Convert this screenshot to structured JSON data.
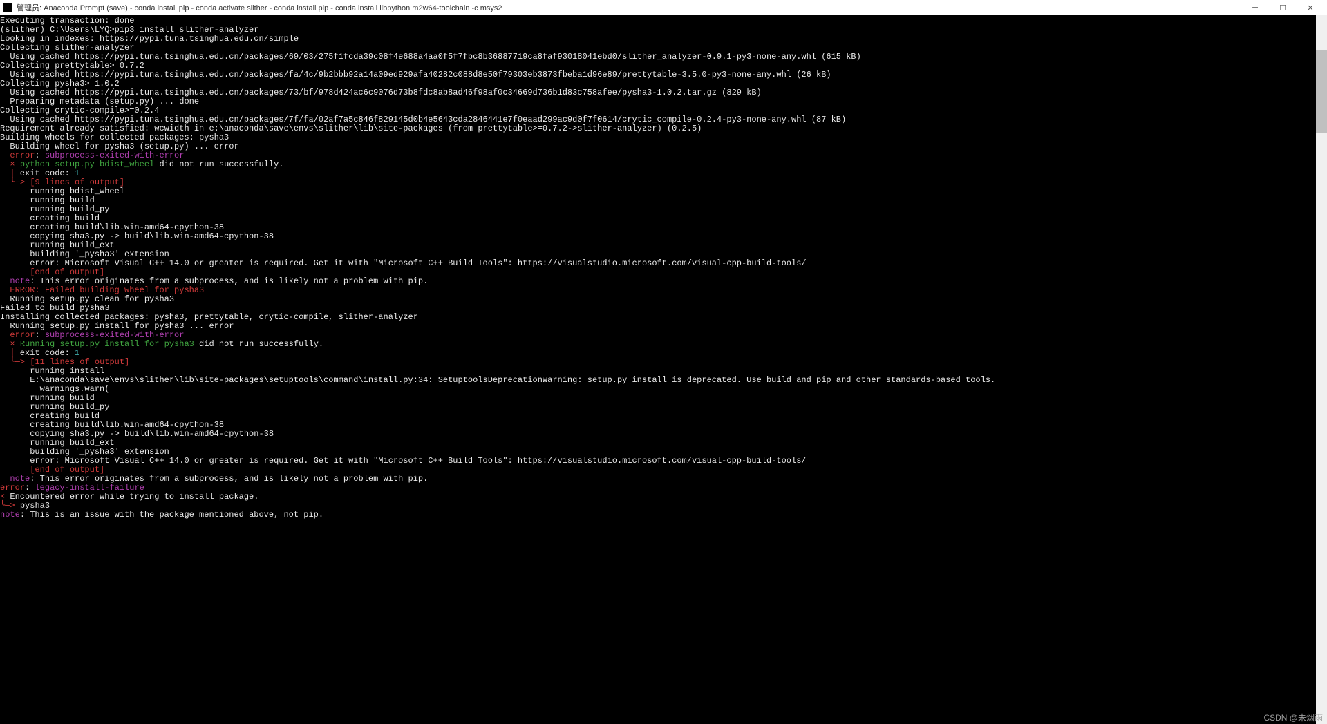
{
  "titlebar": {
    "title": "管理员: Anaconda Prompt (save) - conda  install pip - conda  activate slither - conda  install pip - conda  install libpython m2w64-toolchain -c msys2"
  },
  "watermark": "CSDN @未烟雨",
  "lines": [
    {
      "segs": [
        {
          "c": "white",
          "t": "Executing transaction: done"
        }
      ]
    },
    {
      "segs": [
        {
          "c": "white",
          "t": ""
        }
      ]
    },
    {
      "segs": [
        {
          "c": "white",
          "t": "(slither) C:\\Users\\LYQ>pip3 install slither-analyzer"
        }
      ]
    },
    {
      "segs": [
        {
          "c": "white",
          "t": "Looking in indexes: https://pypi.tuna.tsinghua.edu.cn/simple"
        }
      ]
    },
    {
      "segs": [
        {
          "c": "white",
          "t": "Collecting slither-analyzer"
        }
      ]
    },
    {
      "segs": [
        {
          "c": "white",
          "t": "  Using cached https://pypi.tuna.tsinghua.edu.cn/packages/69/03/275f1fcda39c08f4e688a4aa0f5f7fbc8b36887719ca8faf93018041ebd0/slither_analyzer-0.9.1-py3-none-any.whl (615 kB)"
        }
      ]
    },
    {
      "segs": [
        {
          "c": "white",
          "t": "Collecting prettytable>=0.7.2"
        }
      ]
    },
    {
      "segs": [
        {
          "c": "white",
          "t": "  Using cached https://pypi.tuna.tsinghua.edu.cn/packages/fa/4c/9b2bbb92a14a09ed929afa40282c088d8e50f79303eb3873fbeba1d96e89/prettytable-3.5.0-py3-none-any.whl (26 kB)"
        }
      ]
    },
    {
      "segs": [
        {
          "c": "white",
          "t": "Collecting pysha3>=1.0.2"
        }
      ]
    },
    {
      "segs": [
        {
          "c": "white",
          "t": "  Using cached https://pypi.tuna.tsinghua.edu.cn/packages/73/bf/978d424ac6c9076d73b8fdc8ab8ad46f98af0c34669d736b1d83c758afee/pysha3-1.0.2.tar.gz (829 kB)"
        }
      ]
    },
    {
      "segs": [
        {
          "c": "white",
          "t": "  Preparing metadata (setup.py) ... done"
        }
      ]
    },
    {
      "segs": [
        {
          "c": "white",
          "t": "Collecting crytic-compile>=0.2.4"
        }
      ]
    },
    {
      "segs": [
        {
          "c": "white",
          "t": "  Using cached https://pypi.tuna.tsinghua.edu.cn/packages/7f/fa/02af7a5c846f829145d0b4e5643cda2846441e7f0eaad299ac9d0f7f0614/crytic_compile-0.2.4-py3-none-any.whl (87 kB)"
        }
      ]
    },
    {
      "segs": [
        {
          "c": "white",
          "t": "Requirement already satisfied: wcwidth in e:\\anaconda\\save\\envs\\slither\\lib\\site-packages (from prettytable>=0.7.2->slither-analyzer) (0.2.5)"
        }
      ]
    },
    {
      "segs": [
        {
          "c": "white",
          "t": "Building wheels for collected packages: pysha3"
        }
      ]
    },
    {
      "segs": [
        {
          "c": "white",
          "t": "  Building wheel for pysha3 (setup.py) ... error"
        }
      ]
    },
    {
      "segs": [
        {
          "c": "white",
          "t": "  "
        },
        {
          "c": "red",
          "t": "error"
        },
        {
          "c": "white",
          "t": ": "
        },
        {
          "c": "magenta",
          "t": "subprocess-exited-with-error"
        }
      ]
    },
    {
      "segs": [
        {
          "c": "white",
          "t": ""
        }
      ]
    },
    {
      "segs": [
        {
          "c": "white",
          "t": "  "
        },
        {
          "c": "red",
          "t": "×"
        },
        {
          "c": "white",
          "t": " "
        },
        {
          "c": "green",
          "t": "python setup.py bdist_wheel"
        },
        {
          "c": "white",
          "t": " did not run successfully."
        }
      ]
    },
    {
      "segs": [
        {
          "c": "white",
          "t": "  "
        },
        {
          "c": "red",
          "t": "│"
        },
        {
          "c": "white",
          "t": " exit code: "
        },
        {
          "c": "cyan",
          "t": "1"
        }
      ]
    },
    {
      "segs": [
        {
          "c": "white",
          "t": "  "
        },
        {
          "c": "red",
          "t": "╰─>"
        },
        {
          "c": "white",
          "t": " "
        },
        {
          "c": "red",
          "t": "[9 lines of output]"
        }
      ]
    },
    {
      "segs": [
        {
          "c": "white",
          "t": "      running bdist_wheel"
        }
      ]
    },
    {
      "segs": [
        {
          "c": "white",
          "t": "      running build"
        }
      ]
    },
    {
      "segs": [
        {
          "c": "white",
          "t": "      running build_py"
        }
      ]
    },
    {
      "segs": [
        {
          "c": "white",
          "t": "      creating build"
        }
      ]
    },
    {
      "segs": [
        {
          "c": "white",
          "t": "      creating build\\lib.win-amd64-cpython-38"
        }
      ]
    },
    {
      "segs": [
        {
          "c": "white",
          "t": "      copying sha3.py -> build\\lib.win-amd64-cpython-38"
        }
      ]
    },
    {
      "segs": [
        {
          "c": "white",
          "t": "      running build_ext"
        }
      ]
    },
    {
      "segs": [
        {
          "c": "white",
          "t": "      building '_pysha3' extension"
        }
      ]
    },
    {
      "segs": [
        {
          "c": "white",
          "t": "      error: Microsoft Visual C++ 14.0 or greater is required. Get it with \"Microsoft C++ Build Tools\": https://visualstudio.microsoft.com/visual-cpp-build-tools/"
        }
      ]
    },
    {
      "segs": [
        {
          "c": "white",
          "t": "      "
        },
        {
          "c": "red",
          "t": "[end of output]"
        }
      ]
    },
    {
      "segs": [
        {
          "c": "white",
          "t": ""
        }
      ]
    },
    {
      "segs": [
        {
          "c": "white",
          "t": "  "
        },
        {
          "c": "magenta",
          "t": "note"
        },
        {
          "c": "white",
          "t": ": This error originates from a subprocess, and is likely not a problem with pip."
        }
      ]
    },
    {
      "segs": [
        {
          "c": "white",
          "t": "  "
        },
        {
          "c": "red",
          "t": "ERROR: Failed building wheel for pysha3"
        }
      ]
    },
    {
      "segs": [
        {
          "c": "white",
          "t": "  Running setup.py clean for pysha3"
        }
      ]
    },
    {
      "segs": [
        {
          "c": "white",
          "t": "Failed to build pysha3"
        }
      ]
    },
    {
      "segs": [
        {
          "c": "white",
          "t": "Installing collected packages: pysha3, prettytable, crytic-compile, slither-analyzer"
        }
      ]
    },
    {
      "segs": [
        {
          "c": "white",
          "t": "  Running setup.py install for pysha3 ... error"
        }
      ]
    },
    {
      "segs": [
        {
          "c": "white",
          "t": "  "
        },
        {
          "c": "red",
          "t": "error"
        },
        {
          "c": "white",
          "t": ": "
        },
        {
          "c": "magenta",
          "t": "subprocess-exited-with-error"
        }
      ]
    },
    {
      "segs": [
        {
          "c": "white",
          "t": ""
        }
      ]
    },
    {
      "segs": [
        {
          "c": "white",
          "t": "  "
        },
        {
          "c": "red",
          "t": "×"
        },
        {
          "c": "white",
          "t": " "
        },
        {
          "c": "green",
          "t": "Running setup.py install for pysha3"
        },
        {
          "c": "white",
          "t": " did not run successfully."
        }
      ]
    },
    {
      "segs": [
        {
          "c": "white",
          "t": "  "
        },
        {
          "c": "red",
          "t": "│"
        },
        {
          "c": "white",
          "t": " exit code: "
        },
        {
          "c": "cyan",
          "t": "1"
        }
      ]
    },
    {
      "segs": [
        {
          "c": "white",
          "t": "  "
        },
        {
          "c": "red",
          "t": "╰─>"
        },
        {
          "c": "white",
          "t": " "
        },
        {
          "c": "red",
          "t": "[11 lines of output]"
        }
      ]
    },
    {
      "segs": [
        {
          "c": "white",
          "t": "      running install"
        }
      ]
    },
    {
      "segs": [
        {
          "c": "white",
          "t": "      E:\\anaconda\\save\\envs\\slither\\lib\\site-packages\\setuptools\\command\\install.py:34: SetuptoolsDeprecationWarning: setup.py install is deprecated. Use build and pip and other standards-based tools."
        }
      ]
    },
    {
      "segs": [
        {
          "c": "white",
          "t": "        warnings.warn("
        }
      ]
    },
    {
      "segs": [
        {
          "c": "white",
          "t": "      running build"
        }
      ]
    },
    {
      "segs": [
        {
          "c": "white",
          "t": "      running build_py"
        }
      ]
    },
    {
      "segs": [
        {
          "c": "white",
          "t": "      creating build"
        }
      ]
    },
    {
      "segs": [
        {
          "c": "white",
          "t": "      creating build\\lib.win-amd64-cpython-38"
        }
      ]
    },
    {
      "segs": [
        {
          "c": "white",
          "t": "      copying sha3.py -> build\\lib.win-amd64-cpython-38"
        }
      ]
    },
    {
      "segs": [
        {
          "c": "white",
          "t": "      running build_ext"
        }
      ]
    },
    {
      "segs": [
        {
          "c": "white",
          "t": "      building '_pysha3' extension"
        }
      ]
    },
    {
      "segs": [
        {
          "c": "white",
          "t": "      error: Microsoft Visual C++ 14.0 or greater is required. Get it with \"Microsoft C++ Build Tools\": https://visualstudio.microsoft.com/visual-cpp-build-tools/"
        }
      ]
    },
    {
      "segs": [
        {
          "c": "white",
          "t": "      "
        },
        {
          "c": "red",
          "t": "[end of output]"
        }
      ]
    },
    {
      "segs": [
        {
          "c": "white",
          "t": ""
        }
      ]
    },
    {
      "segs": [
        {
          "c": "white",
          "t": "  "
        },
        {
          "c": "magenta",
          "t": "note"
        },
        {
          "c": "white",
          "t": ": This error originates from a subprocess, and is likely not a problem with pip."
        }
      ]
    },
    {
      "segs": [
        {
          "c": "red",
          "t": "error"
        },
        {
          "c": "white",
          "t": ": "
        },
        {
          "c": "magenta",
          "t": "legacy-install-failure"
        }
      ]
    },
    {
      "segs": [
        {
          "c": "white",
          "t": ""
        }
      ]
    },
    {
      "segs": [
        {
          "c": "red",
          "t": "×"
        },
        {
          "c": "white",
          "t": " Encountered error while trying to install package."
        }
      ]
    },
    {
      "segs": [
        {
          "c": "red",
          "t": "╰─>"
        },
        {
          "c": "white",
          "t": " pysha3"
        }
      ]
    },
    {
      "segs": [
        {
          "c": "white",
          "t": ""
        }
      ]
    },
    {
      "segs": [
        {
          "c": "magenta",
          "t": "note"
        },
        {
          "c": "white",
          "t": ": This is an issue with the package mentioned above, not pip."
        }
      ]
    }
  ]
}
